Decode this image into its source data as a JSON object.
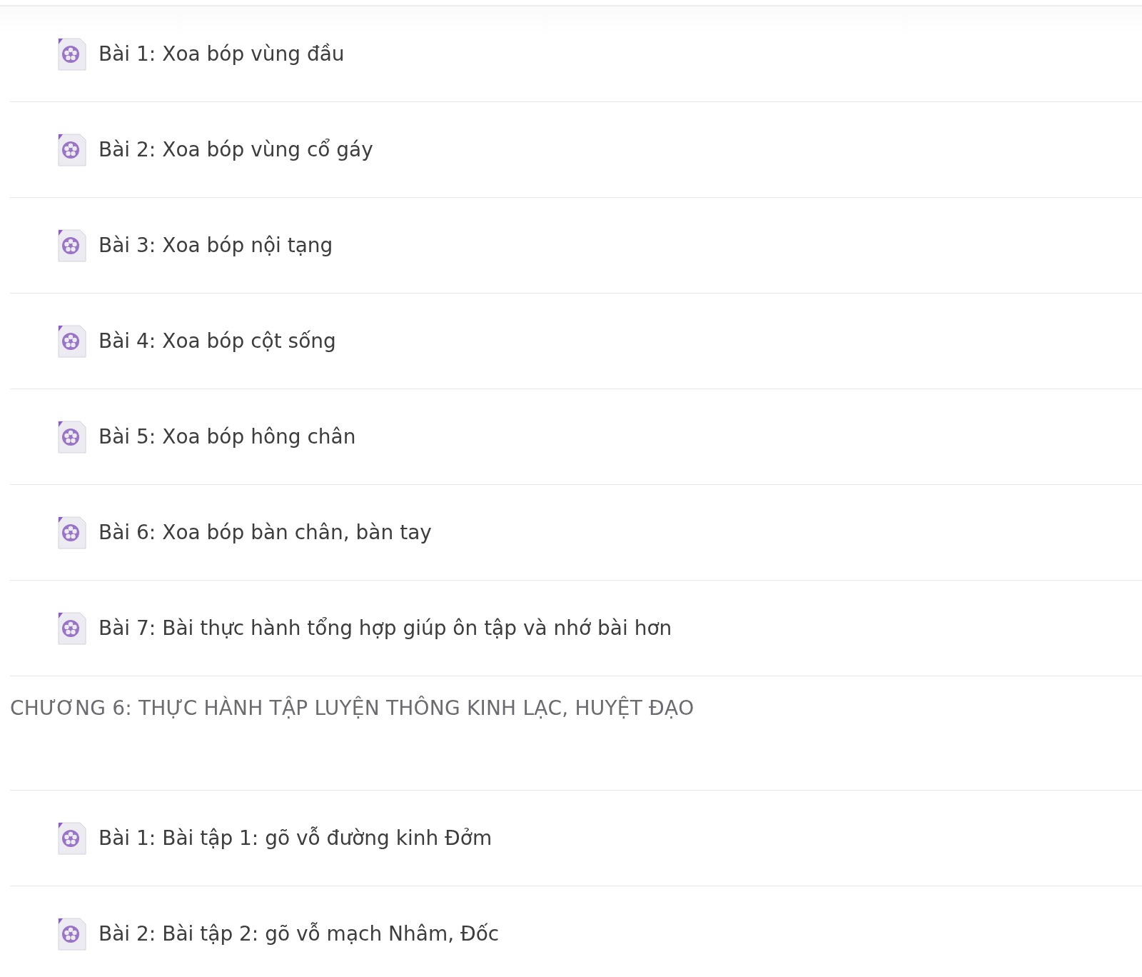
{
  "chapters": [
    {
      "lessons": [
        "Bài 1: Xoa bóp vùng đầu",
        "Bài 2: Xoa bóp vùng cổ gáy",
        "Bài 3: Xoa bóp nội tạng",
        "Bài 4: Xoa bóp cột sống",
        "Bài 5: Xoa bóp hông chân",
        "Bài 6: Xoa bóp bàn chân, bàn tay",
        "Bài 7: Bài thực hành tổng hợp giúp ôn tập và nhớ bài hơn"
      ]
    },
    {
      "title": "CHƯƠNG 6: THỰC HÀNH TẬP LUYỆN THÔNG KINH LẠC, HUYỆT ĐẠO",
      "lessons": [
        "Bài 1: Bài tập 1: gõ vỗ đường kinh Đởm",
        "Bài 2: Bài tập 2: gõ vỗ mạch Nhâm, Đốc"
      ]
    }
  ]
}
